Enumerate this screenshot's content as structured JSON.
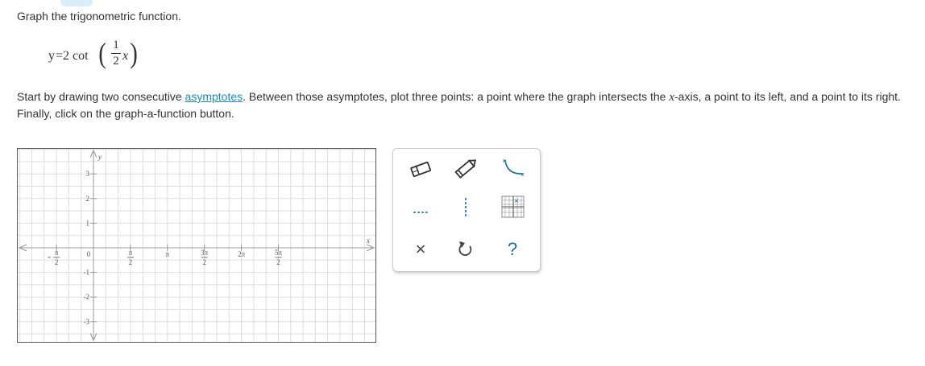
{
  "prompt": "Graph the trigonometric function.",
  "equation": {
    "lhs": "y",
    "rhs_prefix": "=2 cot",
    "frac_num": "1",
    "frac_den": "2",
    "variable": "x"
  },
  "instructions": {
    "part1": "Start by drawing two consecutive ",
    "link": "asymptotes",
    "part2": ". Between those asymptotes, plot three points: a point where the graph intersects the ",
    "var": "x",
    "part3": "-axis, a point to its left, and a point to its right. Finally, click on the graph-a-function button."
  },
  "graph": {
    "x_axis_label": "x",
    "y_axis_label": "y",
    "x_ticks": [
      {
        "value": -1.5708,
        "num": "π",
        "den": "2",
        "neg": true
      },
      {
        "value": 0,
        "label": "0"
      },
      {
        "value": 1.5708,
        "num": "π",
        "den": "2"
      },
      {
        "value": 3.1416,
        "label": "π"
      },
      {
        "value": 4.7124,
        "num": "3π",
        "den": "2"
      },
      {
        "value": 6.2832,
        "label": "2π"
      },
      {
        "value": 7.854,
        "num": "5π",
        "den": "2"
      }
    ],
    "y_ticks": [
      {
        "value": 3,
        "label": "3"
      },
      {
        "value": 2,
        "label": "2"
      },
      {
        "value": 1,
        "label": "1"
      },
      {
        "value": -1,
        "label": "-1"
      },
      {
        "value": -2,
        "label": "-2"
      },
      {
        "value": -3,
        "label": "-3"
      }
    ]
  },
  "toolbox": {
    "tools": [
      {
        "name": "eraser-tool",
        "icon": "eraser-icon"
      },
      {
        "name": "pencil-tool",
        "icon": "pencil-icon"
      },
      {
        "name": "graph-function-tool",
        "icon": "cotangent-curve-icon"
      },
      {
        "name": "horizontal-asymptote-tool",
        "icon": "dashed-horizontal-line-icon"
      },
      {
        "name": "vertical-asymptote-tool",
        "icon": "dashed-vertical-line-icon"
      },
      {
        "name": "grid-points-tool",
        "icon": "grid-points-icon"
      },
      {
        "name": "clear-button",
        "label": "×"
      },
      {
        "name": "undo-button",
        "icon": "undo-icon"
      },
      {
        "name": "help-button",
        "label": "?"
      }
    ]
  },
  "colors": {
    "accent": "#1e8bb5",
    "grid": "#dddddd",
    "axis": "#999999",
    "tool_blue": "#1a6e94"
  }
}
